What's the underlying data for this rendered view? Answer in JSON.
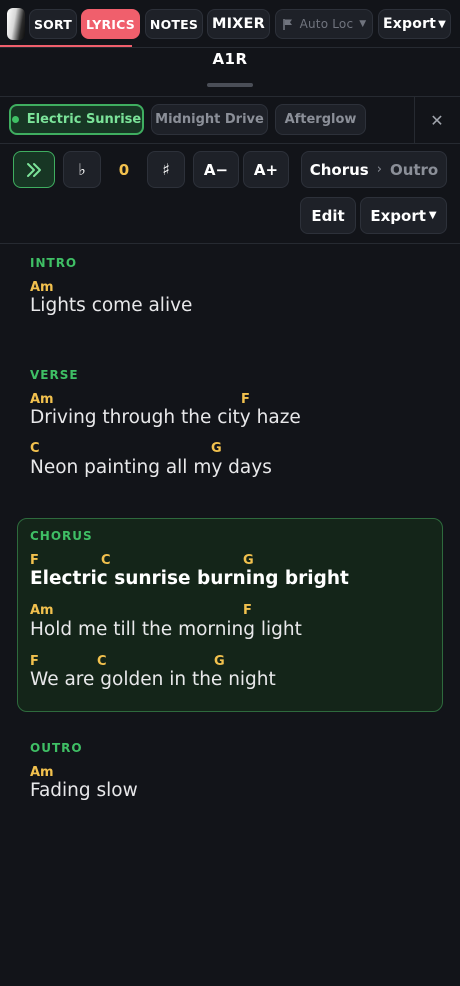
{
  "toolbar": {
    "sort": "SORT",
    "lyrics": "LYRICS",
    "notes": "NOTES",
    "mixer": "MIXER",
    "auto_loc": "Auto Loc",
    "export": "Export"
  },
  "title": "A1R",
  "songs": [
    "Electric Sunrise",
    "Midnight Drive",
    "Afterglow"
  ],
  "active_song": "Electric Sunrise",
  "controls": {
    "flat": "♭",
    "transpose": "0",
    "sharp": "♯",
    "font_down": "A−",
    "font_up": "A+",
    "current_section": "Chorus",
    "next_section": "Outro",
    "edit": "Edit",
    "export": "Export"
  },
  "sections": {
    "intro": {
      "label": "INTRO",
      "lines": [
        {
          "chords": [
            "Am"
          ],
          "text": "Lights come alive"
        }
      ]
    },
    "verse": {
      "label": "VERSE",
      "lines": [
        {
          "chords": [
            "Am",
            "F"
          ],
          "text": "Driving through the city haze"
        },
        {
          "chords": [
            "C",
            "G"
          ],
          "text": "Neon painting all my days"
        }
      ]
    },
    "chorus": {
      "label": "CHORUS",
      "lines": [
        {
          "chords": [
            "F",
            "C",
            "G"
          ],
          "text": "Electric sunrise burning bright"
        },
        {
          "chords": [
            "Am",
            "F"
          ],
          "text": "Hold me till the morning light"
        },
        {
          "chords": [
            "F",
            "C",
            "G"
          ],
          "text": "We are golden in the night"
        }
      ]
    },
    "outro": {
      "label": "OUTRO",
      "lines": [
        {
          "chords": [
            "Am"
          ],
          "text": "Fading slow"
        }
      ]
    }
  },
  "colors": {
    "background": "#121419",
    "accent_red": "#f05f6c",
    "accent_green": "#3fbf65",
    "chord_yellow": "#f2c14e"
  },
  "icons": {
    "logo": "app-logo",
    "flag": "flag-icon",
    "skip": "double-chevron-right-icon",
    "close": "close-icon",
    "chevron": "chevron-right-icon",
    "caret": "caret-down-icon"
  }
}
